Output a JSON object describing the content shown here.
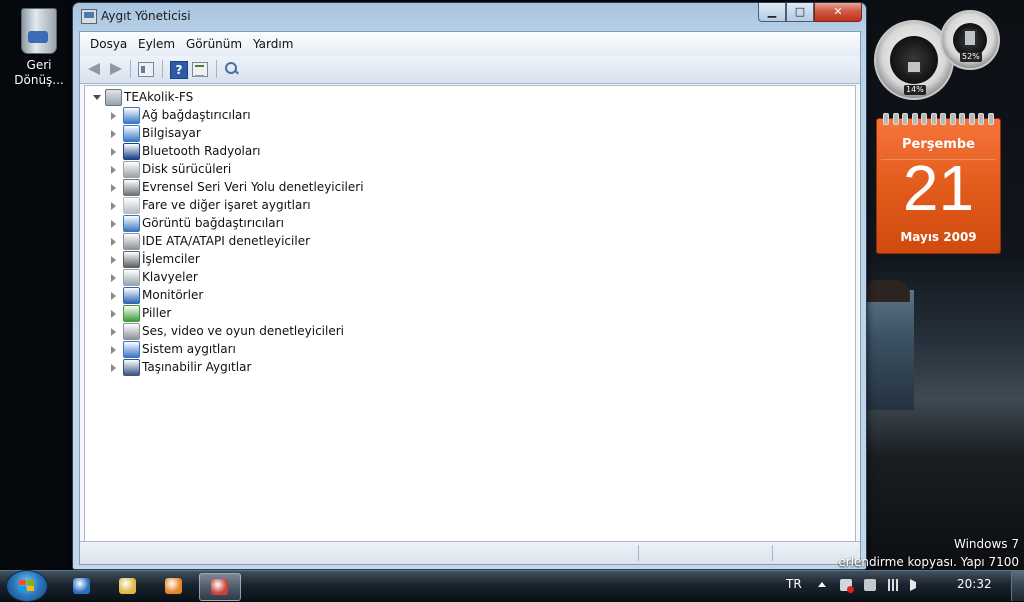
{
  "desktop": {
    "recycle_bin_label_line1": "Geri",
    "recycle_bin_label_line2": "Dönüş..."
  },
  "window": {
    "title": "Aygıt Yöneticisi",
    "controls": {
      "minimize": "▁",
      "maximize": "□",
      "close": "✕"
    }
  },
  "menu": [
    "Dosya",
    "Eylem",
    "Görünüm",
    "Yardım"
  ],
  "toolbar": {
    "icons": [
      "back-arrow-icon",
      "forward-arrow-icon",
      "properties-icon",
      "help-icon",
      "update-driver-icon",
      "scan-hardware-icon"
    ],
    "help_glyph": "?"
  },
  "tree": {
    "root": "TEAkolik-FS",
    "items": [
      {
        "label": "Ağ bağdaştırıcıları",
        "icon": "network-adapter-icon",
        "color": "#3b77c5"
      },
      {
        "label": "Bilgisayar",
        "icon": "computer-icon",
        "color": "#3b77c5"
      },
      {
        "label": "Bluetooth Radyoları",
        "icon": "bluetooth-icon",
        "color": "#1d3f86"
      },
      {
        "label": "Disk sürücüleri",
        "icon": "disk-drive-icon",
        "color": "#9aa3ab"
      },
      {
        "label": "Evrensel Seri Veri Yolu denetleyicileri",
        "icon": "usb-icon",
        "color": "#6d747a"
      },
      {
        "label": "Fare ve diğer işaret aygıtları",
        "icon": "mouse-icon",
        "color": "#b9bec3"
      },
      {
        "label": "Görüntü bağdaştırıcıları",
        "icon": "display-adapter-icon",
        "color": "#3b77c5"
      },
      {
        "label": "IDE ATA/ATAPI denetleyiciler",
        "icon": "ide-controller-icon",
        "color": "#8b949c"
      },
      {
        "label": "İşlemciler",
        "icon": "processor-icon",
        "color": "#5c6166"
      },
      {
        "label": "Klavyeler",
        "icon": "keyboard-icon",
        "color": "#9aa3ab"
      },
      {
        "label": "Monitörler",
        "icon": "monitor-icon",
        "color": "#2f66b3"
      },
      {
        "label": "Piller",
        "icon": "battery-icon",
        "color": "#3f9a3a"
      },
      {
        "label": "Ses, video ve oyun denetleyicileri",
        "icon": "speaker-icon",
        "color": "#8d949a"
      },
      {
        "label": "Sistem aygıtları",
        "icon": "system-devices-icon",
        "color": "#3b77c5"
      },
      {
        "label": "Taşınabilir Aygıtlar",
        "icon": "portable-devices-icon",
        "color": "#3a5680"
      }
    ]
  },
  "gadgets": {
    "cpu_meter": {
      "cpu_percent": "14%",
      "memory_percent": "52%"
    },
    "calendar": {
      "weekday": "Perşembe",
      "day": "21",
      "month_year": "Mayıs 2009"
    }
  },
  "watermark": {
    "line1": "Windows 7",
    "line2": "erlendirme kopyası. Yapı 7100"
  },
  "taskbar": {
    "pinned": [
      {
        "name": "internet-explorer-icon",
        "color": "#2b6fc2"
      },
      {
        "name": "windows-explorer-icon",
        "color": "#e0b845"
      },
      {
        "name": "media-player-icon",
        "color": "#e7862a"
      },
      {
        "name": "device-manager-icon",
        "color": "#c9413a"
      }
    ],
    "language": "TR",
    "clock": "20:32"
  }
}
